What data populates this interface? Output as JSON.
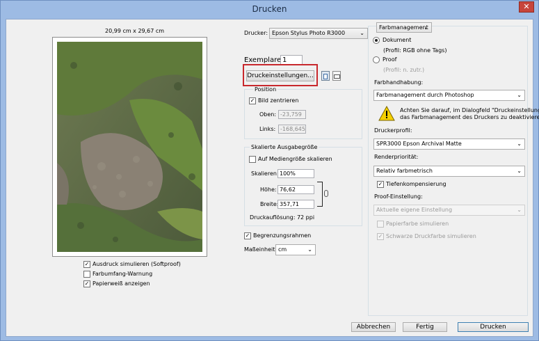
{
  "window": {
    "title": "Drucken",
    "close_glyph": "✕"
  },
  "preview": {
    "paper_size": "20,99 cm x 29,67 cm"
  },
  "left_checks": [
    {
      "label": "Ausdruck simulieren (Softproof)",
      "checked": true
    },
    {
      "label": "Farbumfang-Warnung",
      "checked": false
    },
    {
      "label": "Papierweiß anzeigen",
      "checked": true
    }
  ],
  "printer": {
    "label": "Drucker:",
    "value": "Epson Stylus Photo R3000"
  },
  "copies": {
    "label": "Exemplare:",
    "value": "1"
  },
  "print_settings_button": "Druckeinstellungen...",
  "position": {
    "title": "Position",
    "center_label": "Bild zentrieren",
    "center_checked": true,
    "top_label": "Oben:",
    "top_value": "-23,759",
    "left_label": "Links:",
    "left_value": "-168,645"
  },
  "scaled": {
    "title": "Skalierte Ausgabegröße",
    "fit_label": "Auf Mediengröße skalieren",
    "fit_checked": false,
    "scale_label": "Skalieren:",
    "scale_value": "100%",
    "height_label": "Höhe:",
    "height_value": "76,62",
    "width_label": "Breite:",
    "width_value": "357,71",
    "resolution": "Druckauflösung: 72 ppi"
  },
  "bounding_box": {
    "label": "Begrenzungsrahmen",
    "checked": true
  },
  "units": {
    "label": "Maßeinheit:",
    "value": "cm"
  },
  "color_management": {
    "dropdown": "Farbmanagement",
    "document_label": "Dokument",
    "document_selected": true,
    "document_profile": "(Profil: RGB ohne Tags)",
    "proof_label": "Proof",
    "proof_profile": "(Profil: n. zutr.)",
    "handling_label": "Farbhandhabung:",
    "handling_value": "Farbmanagement durch Photoshop",
    "warning_line1": "Achten Sie darauf, im Dialogfeld \"Druckeinstellungen\"",
    "warning_line2": "das Farbmanagement des Druckers zu deaktivieren.",
    "profile_label": "Druckerprofil:",
    "profile_value": "SPR3000 Epson Archival Matte",
    "intent_label": "Renderpriorität:",
    "intent_value": "Relativ farbmetrisch",
    "bpc_label": "Tiefenkompensierung",
    "bpc_checked": true,
    "proof_setup_label": "Proof-Einstellung:",
    "proof_setup_value": "Aktuelle eigene Einstellung",
    "paper_color_label": "Papierfarbe simulieren",
    "black_ink_label": "Schwarze Druckfarbe simulieren"
  },
  "buttons": {
    "cancel": "Abbrechen",
    "done": "Fertig",
    "print": "Drucken"
  },
  "colors": {
    "highlight": "#c8282d",
    "title_bar": "#9dbbe4",
    "default_button": "#3c7fb1"
  }
}
